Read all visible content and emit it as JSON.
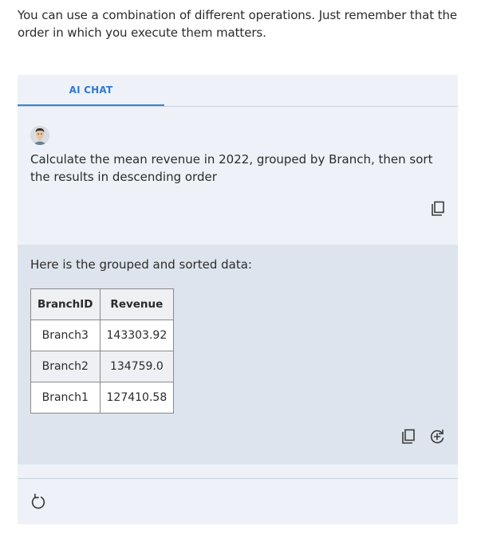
{
  "intro": {
    "text": "You can use a combination of different operations. Just remember that the order in which you execute them matters."
  },
  "tabs": [
    {
      "label": "AI CHAT",
      "active": true
    }
  ],
  "user_message": {
    "text": "Calculate the mean revenue in 2022, grouped by Branch, then sort the results in descending order",
    "icons": [
      "user-avatar",
      "copy-icon"
    ]
  },
  "bot_message": {
    "text": "Here is the grouped and sorted data:",
    "table": {
      "headers": [
        "BranchID",
        "Revenue"
      ],
      "rows": [
        [
          "Branch3",
          "143303.92"
        ],
        [
          "Branch2",
          "134759.0"
        ],
        [
          "Branch1",
          "127410.58"
        ]
      ]
    },
    "icons": [
      "copy-icon",
      "regenerate-plus-icon"
    ]
  },
  "footer": {
    "icons": [
      "refresh-icon"
    ]
  },
  "colors": {
    "accent": "#2f7bd1",
    "panel": "#eef2f8",
    "bot_bg": "#dde4ee"
  }
}
